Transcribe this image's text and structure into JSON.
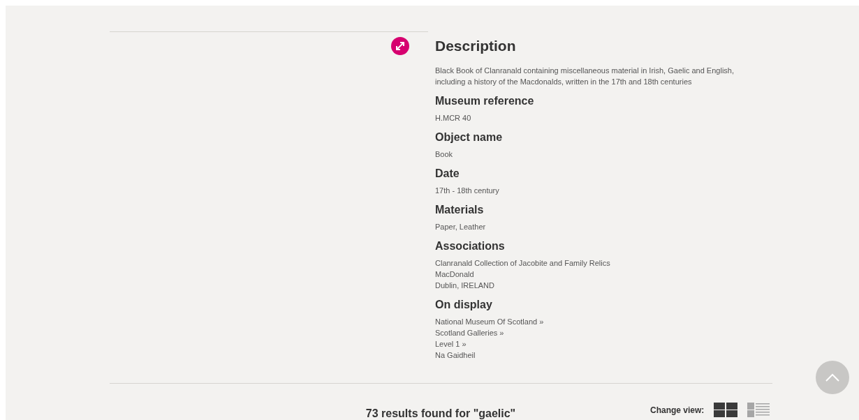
{
  "sections": [
    {
      "heading": "Description",
      "lines": [
        "Black Book of Clanranald containing miscellaneous material in Irish, Gaelic and English, including a history of the Macdonalds, written in the 17th and 18th centuries"
      ]
    },
    {
      "heading": "Museum reference",
      "lines": [
        "H.MCR 40"
      ]
    },
    {
      "heading": "Object name",
      "lines": [
        "Book"
      ]
    },
    {
      "heading": "Date",
      "lines": [
        "17th - 18th century"
      ]
    },
    {
      "heading": "Materials",
      "lines": [
        "Paper, Leather"
      ]
    },
    {
      "heading": "Associations",
      "lines": [
        "Clanranald Collection of Jacobite and Family Relics",
        "MacDonald",
        "Dublin, IRELAND"
      ]
    },
    {
      "heading": "On display",
      "lines": [
        "National Museum Of Scotland »",
        "Scotland Galleries »",
        "Level 1 »",
        "Na Gaidheil"
      ]
    }
  ],
  "results": {
    "summary": "73 results found for \"gaelic\"",
    "change_view_label": "Change view:",
    "views": [
      {
        "kind": "grid",
        "selected": true
      },
      {
        "kind": "list",
        "selected": false
      }
    ]
  }
}
